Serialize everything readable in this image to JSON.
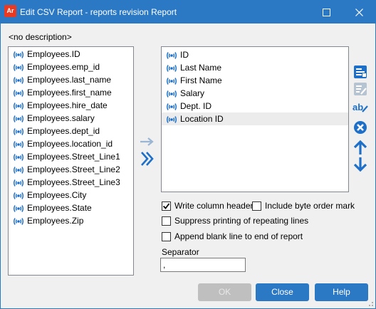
{
  "window": {
    "title": "Edit CSV Report - reports revision Report",
    "app_icon_text": "Ar"
  },
  "description": "<no description>",
  "available_columns": [
    "Employees.ID",
    "Employees.emp_id",
    "Employees.last_name",
    "Employees.first_name",
    "Employees.hire_date",
    "Employees.salary",
    "Employees.dept_id",
    "Employees.location_id",
    "Employees.Street_Line1",
    "Employees.Street_Line2",
    "Employees.Street_Line3",
    "Employees.City",
    "Employees.State",
    "Employees.Zip"
  ],
  "selected_columns": [
    {
      "label": "ID",
      "selected": false
    },
    {
      "label": "Last Name",
      "selected": false
    },
    {
      "label": "First Name",
      "selected": false
    },
    {
      "label": "Salary",
      "selected": false
    },
    {
      "label": "Dept. ID",
      "selected": false
    },
    {
      "label": "Location ID",
      "selected": true
    }
  ],
  "options": {
    "write_column_header": {
      "label": "Write column header",
      "checked": true
    },
    "include_bom": {
      "label": "Include byte order mark",
      "checked": false
    },
    "suppress_repeating": {
      "label": "Suppress printing of repeating lines",
      "checked": false
    },
    "append_blank_line": {
      "label": "Append blank line to end of report",
      "checked": false
    }
  },
  "separator": {
    "label": "Separator",
    "value": ","
  },
  "buttons": {
    "ok": "OK",
    "close": "Close",
    "help": "Help"
  },
  "icons": {
    "column": "column-signal-icon",
    "add": "arrow-right-icon",
    "add_all": "double-chevron-right-icon",
    "edit": "edit-column-icon",
    "rename": "rename-icon",
    "remove": "remove-icon",
    "move_up": "arrow-up-icon",
    "move_down": "arrow-down-icon"
  },
  "colors": {
    "accent": "#2b78c5",
    "icon_blue": "#1e6fc7",
    "disabled": "#bfbfbf"
  }
}
